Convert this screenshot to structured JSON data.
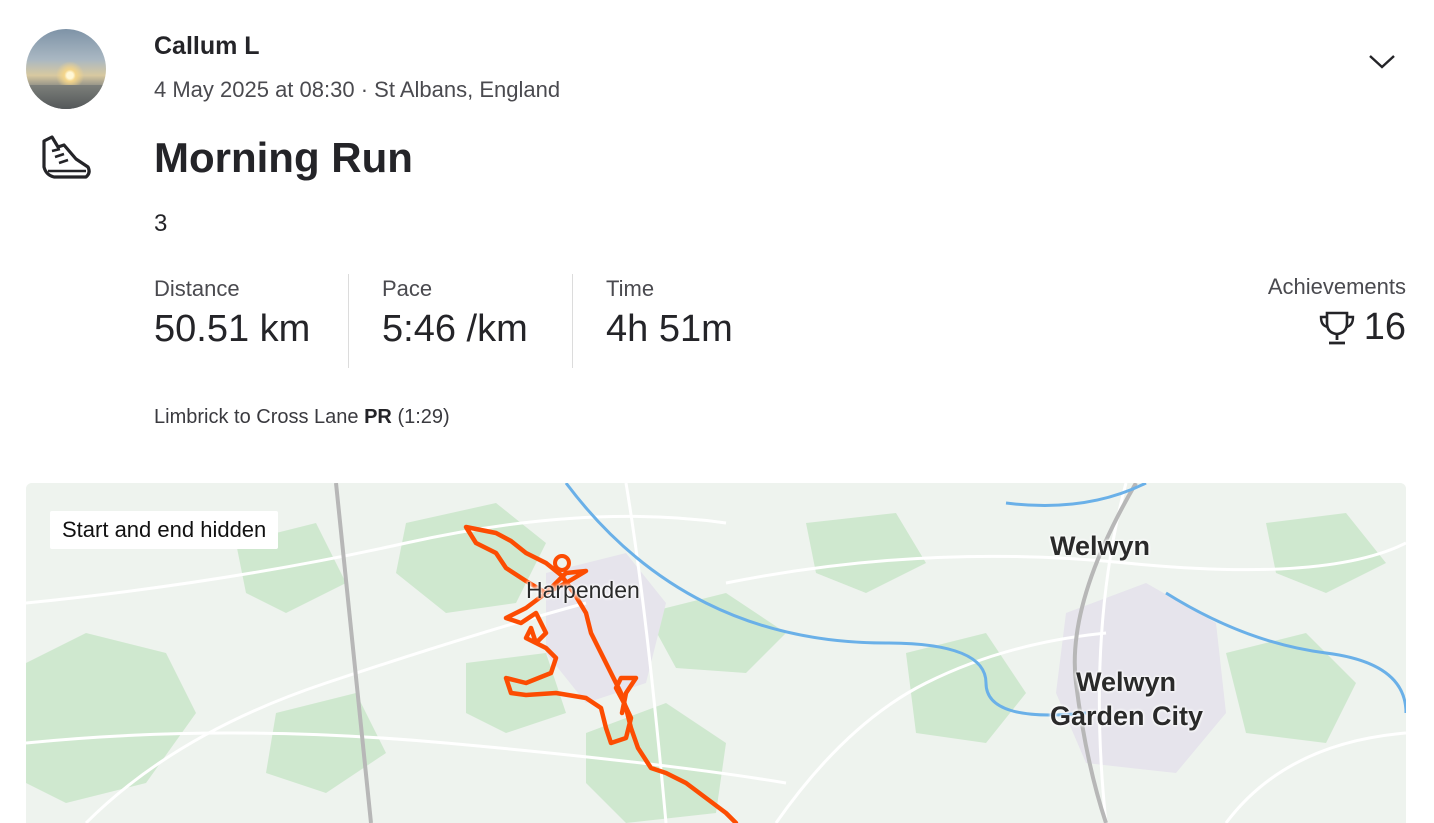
{
  "athlete": {
    "name": "Callum L"
  },
  "activity": {
    "meta": "4 May 2025 at 08:30 · St Albans, England",
    "title": "Morning Run",
    "description": "3",
    "sport_icon": "shoe-icon"
  },
  "stats": [
    {
      "label": "Distance",
      "value": "50.51 km"
    },
    {
      "label": "Pace",
      "value": "5:46 /km"
    },
    {
      "label": "Time",
      "value": "4h 51m"
    }
  ],
  "achievements": {
    "label": "Achievements",
    "count": "16",
    "icon": "trophy-icon"
  },
  "segment": {
    "name": "Limbrick to Cross Lane",
    "badge": "PR",
    "time": "(1:29)"
  },
  "map": {
    "privacy_label": "Start and end hidden",
    "places": [
      "Welwyn",
      "Welwyn",
      "Garden City",
      "Harpenden"
    ],
    "route_color": "#fc4c02",
    "water_color": "#6ab0e8",
    "park_color": "#cfe8cf"
  },
  "colors": {
    "text": "#242428",
    "secondary": "#4a4a4f",
    "accent": "#fc4c02"
  }
}
